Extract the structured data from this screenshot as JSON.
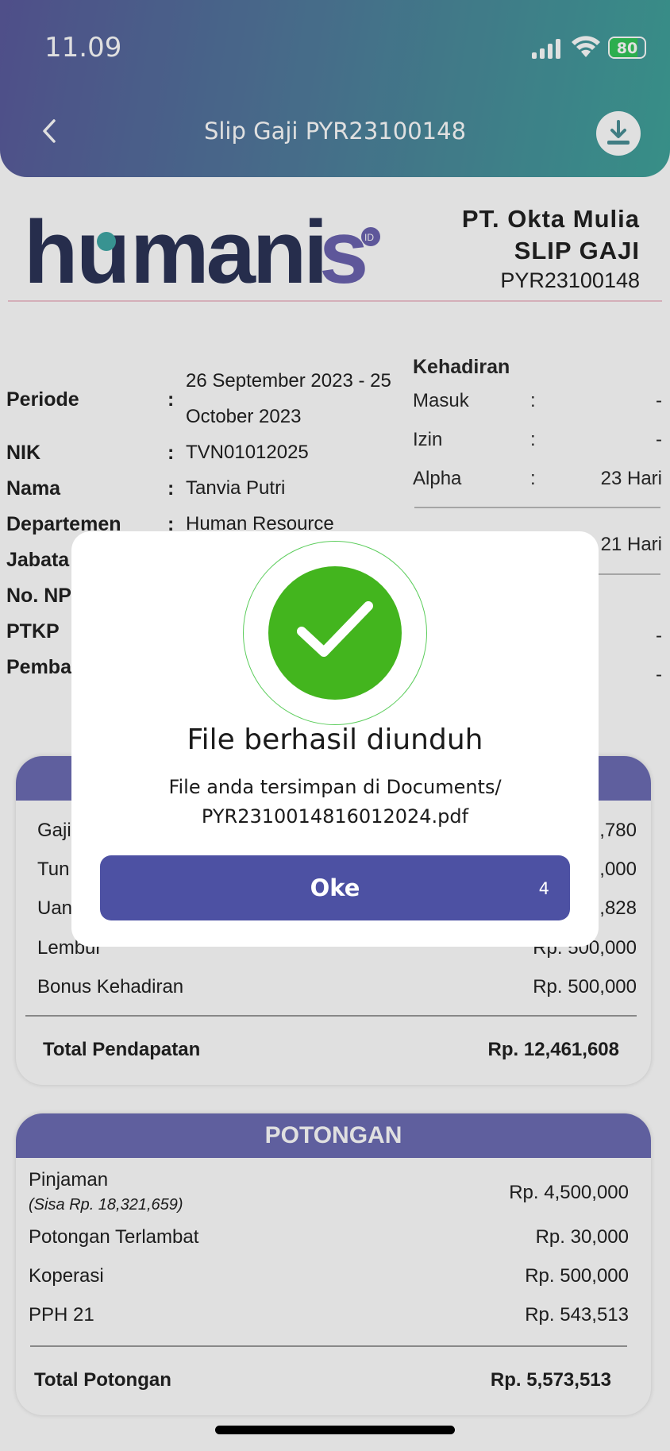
{
  "status_bar": {
    "time": "11.09",
    "battery": "80"
  },
  "header": {
    "title": "Slip Gaji PYR23100148"
  },
  "slip": {
    "logo_text": "humanis",
    "logo_badge": "ID",
    "company": "PT. Okta Mulia",
    "doc_type": "SLIP GAJI",
    "code": "PYR23100148"
  },
  "employee": {
    "periode_label": "Periode",
    "periode_value_line1": "26 September 2023 - 25",
    "periode_value_line2": "October 2023",
    "nik_label": "NIK",
    "nik_value": "TVN01012025",
    "nama_label": "Nama",
    "nama_value": "Tanvia Putri",
    "departemen_label": "Departemen",
    "departemen_value": "Human Resource",
    "jabatan_label": "Jabata",
    "npwp_label": "No. NP",
    "ptkp_label": "PTKP",
    "pembayaran_label": "Pemba",
    "colon": ":"
  },
  "attendance": {
    "title": "Kehadiran",
    "masuk_label": "Masuk",
    "masuk_value": "-",
    "izin_label": "Izin",
    "izin_value": "-",
    "alpha_label": "Alpha",
    "alpha_value": "23 Hari",
    "hari_kerja_value": "21 Hari",
    "extra1_value": "-",
    "extra2_value": "-",
    "colon": ":"
  },
  "pendapatan": {
    "rows": [
      {
        "label": "Gaji",
        "value": ",780"
      },
      {
        "label": "Tun",
        "value": ",000"
      },
      {
        "label": "Uan",
        "value": ",828"
      },
      {
        "label": "Lembur",
        "value": "Rp. 500,000"
      },
      {
        "label": "Bonus Kehadiran",
        "value": "Rp. 500,000"
      }
    ],
    "total_label": "Total Pendapatan",
    "total_value": "Rp. 12,461,608"
  },
  "potongan": {
    "title": "POTONGAN",
    "rows": [
      {
        "label": "Pinjaman",
        "note": "(Sisa Rp. 18,321,659)",
        "value": "Rp. 4,500,000"
      },
      {
        "label": "Potongan Terlambat",
        "value": "Rp. 30,000"
      },
      {
        "label": "Koperasi",
        "value": "Rp. 500,000"
      },
      {
        "label": "PPH 21",
        "value": "Rp. 543,513"
      }
    ],
    "total_label": "Total Potongan",
    "total_value": "Rp. 5,573,513"
  },
  "dialog": {
    "title": "File berhasil diunduh",
    "message_line1": "File anda tersimpan di Documents/",
    "message_line2": "PYR2310014816012024.pdf",
    "ok_label": "Oke",
    "countdown": "4"
  },
  "colors": {
    "header_start": "#5a5a9c",
    "header_end": "#3fa39a",
    "card_header": "#6d6db4",
    "ok_button": "#4d51a3",
    "success": "#43b51e"
  }
}
